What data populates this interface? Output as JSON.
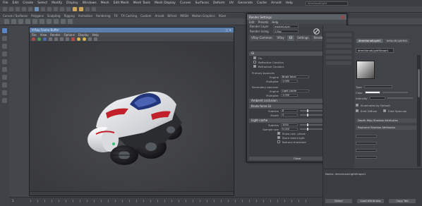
{
  "menubar": {
    "items": [
      "File",
      "Edit",
      "Create",
      "Select",
      "Modify",
      "Display",
      "Windows",
      "Mesh",
      "Edit Mesh",
      "Mesh Tools",
      "Mesh Display",
      "Curves",
      "Surfaces",
      "Deform",
      "UV",
      "Generate",
      "Cache",
      "Arnold",
      "Help"
    ],
    "search_placeholder": "directionalLight"
  },
  "shelf_tabs": [
    "Curves / Surfaces",
    "Polygons",
    "Sculpting",
    "Rigging",
    "Animation",
    "Rendering",
    "FX",
    "FX Caching",
    "Custom",
    "Arnold",
    "Bifrost",
    "MASH",
    "Motion Graphics",
    "XGen"
  ],
  "render_view": {
    "title": "Render View",
    "window_title": "V-Ray Frame Buffer",
    "menu": [
      "File",
      "View",
      "Render",
      "Options",
      "Display",
      "Help"
    ],
    "status": ""
  },
  "dialog": {
    "title": "Render Settings",
    "menu": [
      "Edit",
      "Presets",
      "Help"
    ],
    "render_layer_label": "Render Layer",
    "render_layer_value": "masterLayer",
    "render_using_label": "Render Using",
    "render_using_value": "V-Ray",
    "tabs": [
      "VRay Common",
      "VRay",
      "GI",
      "Settings",
      "Render Elements"
    ],
    "active_tab": "GI",
    "sections": {
      "gi": "GI",
      "primary": "Primary bounces",
      "secondary": "Secondary bounces",
      "ao": "Ambient occlusion",
      "brute": "Brute force GI",
      "light_cache": "Light cache"
    },
    "options": {
      "on": "On",
      "reflective": "Reflective Caustics",
      "refractive": "Refractive Caustics",
      "ao_on": "On"
    },
    "fields": {
      "engine_label": "Engine",
      "primary_engine": "Brute force",
      "primary_mult_label": "Multiplier",
      "primary_mult": "1.000",
      "secondary_engine": "Light cache",
      "secondary_mult": "1.000",
      "subdivs_label": "Subdivs",
      "subdivs": "8",
      "depth_label": "Depth",
      "depth": "3",
      "lc_subdivs": "1000",
      "sample_size_label": "Sample size",
      "sample_size": "0.020"
    },
    "lc_options": {
      "show_calc": "Show calc. phase",
      "store_direct": "Store direct light",
      "retrace": "Retrace threshold"
    },
    "close_label": "Close"
  },
  "attribute_editor": {
    "tabs": [
      "directionalLight1",
      "defaultLightSet"
    ],
    "node_label": "directionalLight:",
    "node_value": "directionalLightShape1",
    "sections": [
      "Directional Light Attributes",
      "Depth Map Shadow Attributes",
      "Raytrace Shadow Attributes"
    ],
    "type_label": "Type",
    "type_value": "Directional Light",
    "color_label": "Color",
    "intensity_label": "Intensity",
    "intensity_value": "1.000",
    "illuminates_label": "Illuminates by Default",
    "emit_diffuse": "Emit Diffuse",
    "emit_specular": "Emit Specular",
    "footer_label": "Notes:",
    "footer_value": "directionalLightShape1",
    "buttons": [
      "Select",
      "Load Attributes",
      "Copy Tab"
    ]
  },
  "timeline": {
    "start": "1"
  }
}
